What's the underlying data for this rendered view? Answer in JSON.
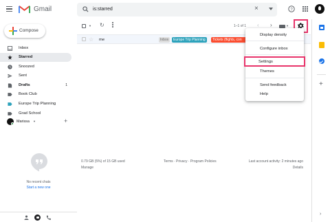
{
  "app": {
    "name": "Gmail"
  },
  "search": {
    "query": "is:starred"
  },
  "compose": {
    "label": "Compose"
  },
  "sidebar": {
    "items": [
      {
        "label": "Inbox",
        "count": ""
      },
      {
        "label": "Starred",
        "count": ""
      },
      {
        "label": "Snoozed",
        "count": ""
      },
      {
        "label": "Sent",
        "count": ""
      },
      {
        "label": "Drafts",
        "count": "1"
      },
      {
        "label": "Book Club",
        "count": ""
      },
      {
        "label": "Europe Trip Planning",
        "count": ""
      },
      {
        "label": "Grad School",
        "count": ""
      }
    ]
  },
  "hangouts": {
    "user": "Marissa",
    "empty_text": "No recent chats",
    "start_link": "Start a new one"
  },
  "toolbar": {
    "pager": "1–1 of 1"
  },
  "messages": [
    {
      "sender": "me",
      "labels": [
        "Inbox",
        "Europe Trip Planning",
        "Tickets (flights, con"
      ]
    }
  ],
  "settings_menu": {
    "items": [
      "Display density",
      "Configure inbox",
      "Settings",
      "Themes",
      "Send feedback",
      "Help"
    ]
  },
  "footer": {
    "storage": "0.79 GB (5%) of 15 GB used",
    "manage": "Manage",
    "links": "Terms · Privacy · Program Policies",
    "activity": "Last account activity: 2 minutes ago",
    "details": "Details"
  },
  "colors": {
    "highlight": "#e8336a",
    "label_europe": "#2da2bb",
    "label_tickets": "#fb4c2f",
    "selected_nav": "#e8eaed"
  },
  "icons": {
    "topbar": [
      "menu-icon",
      "gmail-logo",
      "search-icon",
      "clear-icon",
      "search-options-icon",
      "help-icon",
      "apps-icon",
      "account-avatar"
    ],
    "right_rail": [
      "calendar-icon",
      "keep-icon",
      "tasks-icon",
      "add-addon-icon"
    ]
  }
}
